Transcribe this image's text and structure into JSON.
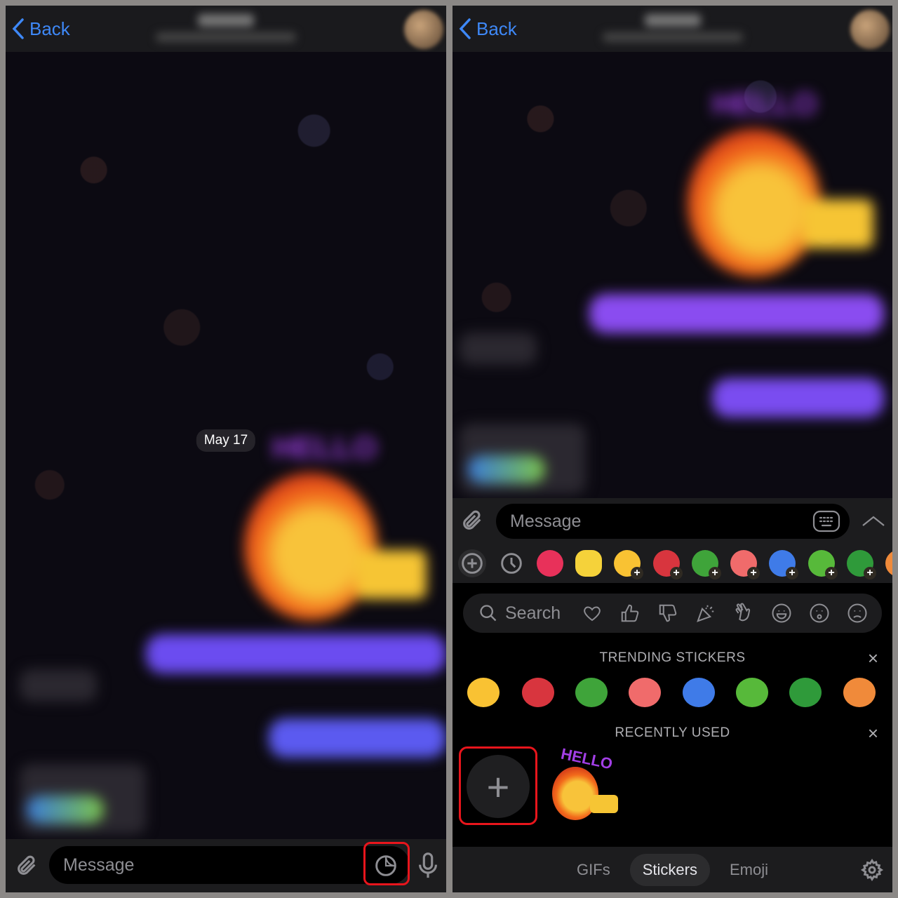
{
  "left": {
    "header": {
      "back_label": "Back"
    },
    "date_label": "May 17",
    "input": {
      "placeholder": "Message"
    },
    "icons": [
      "paperclip-icon",
      "sticker-icon",
      "microphone-icon"
    ]
  },
  "right": {
    "header": {
      "back_label": "Back"
    },
    "input": {
      "placeholder": "Message"
    },
    "search": {
      "placeholder": "Search",
      "categories": [
        "heart",
        "thumbs-up",
        "thumbs-down",
        "party-popper",
        "waving-hand",
        "smiling-face",
        "worried-face",
        "frowning-face"
      ]
    },
    "trending": {
      "title": "TRENDING STICKERS",
      "close": "×"
    },
    "recent": {
      "title": "RECENTLY USED",
      "close": "×",
      "sticker_text": "HELLO"
    },
    "tabs": [
      {
        "label": "GIFs"
      },
      {
        "label": "Stickers",
        "active": true
      },
      {
        "label": "Emoji"
      }
    ]
  },
  "colors": {
    "accent": "#3e88f7",
    "highlight": "#e8151c",
    "bubble": "#6b4cf0"
  }
}
